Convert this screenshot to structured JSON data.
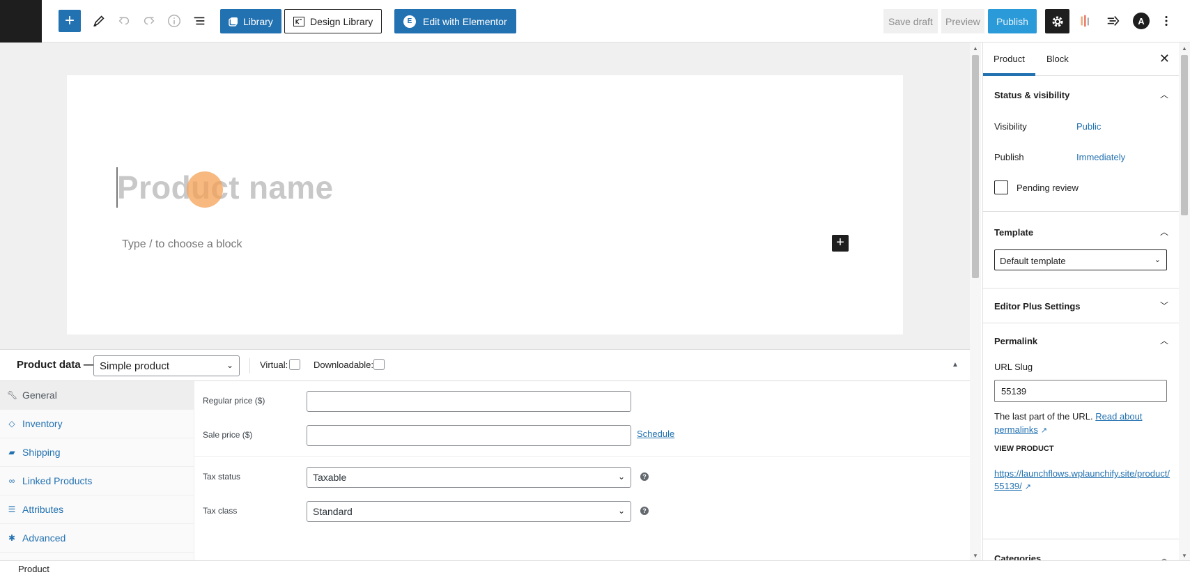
{
  "toolbar": {
    "add_icon": "plus-icon",
    "library_label": "Library",
    "design_library_label": "Design Library",
    "elementor_label": "Edit with Elementor",
    "elementor_icon_text": "E",
    "save_draft_label": "Save draft",
    "preview_label": "Preview",
    "publish_label": "Publish",
    "astra_icon_text": "A",
    "accent_color": "#2271b1"
  },
  "editor": {
    "title_placeholder": "Product name",
    "block_placeholder": "Type / to choose a block"
  },
  "product_data": {
    "title": "Product data —",
    "product_type": "Simple product",
    "virtual_label": "Virtual:",
    "downloadable_label": "Downloadable:",
    "tabs": [
      {
        "label": "General",
        "icon": "wrench-icon"
      },
      {
        "label": "Inventory",
        "icon": "tag-icon"
      },
      {
        "label": "Shipping",
        "icon": "truck-icon"
      },
      {
        "label": "Linked Products",
        "icon": "link-icon"
      },
      {
        "label": "Attributes",
        "icon": "list-icon"
      },
      {
        "label": "Advanced",
        "icon": "gear-icon"
      }
    ],
    "regular_price_label": "Regular price ($)",
    "regular_price_value": "",
    "sale_price_label": "Sale price ($)",
    "sale_price_value": "",
    "schedule_label": "Schedule",
    "tax_status_label": "Tax status",
    "tax_status_value": "Taxable",
    "tax_class_label": "Tax class",
    "tax_class_value": "Standard"
  },
  "footer": {
    "breadcrumb": "Product"
  },
  "sidebar": {
    "tab_product": "Product",
    "tab_block": "Block",
    "status_title": "Status & visibility",
    "visibility_label": "Visibility",
    "visibility_value": "Public",
    "publish_label": "Publish",
    "publish_value": "Immediately",
    "pending_review_label": "Pending review",
    "template_title": "Template",
    "template_value": "Default template",
    "editor_plus_title": "Editor Plus Settings",
    "permalink_title": "Permalink",
    "url_slug_label": "URL Slug",
    "url_slug_value": "55139",
    "help_text": "The last part of the URL.",
    "help_link": "Read about permalinks",
    "view_product_label": "VIEW PRODUCT",
    "view_product_url": "https://launchflows.wplaunchify.site/product/55139/",
    "categories_title": "Categories"
  }
}
